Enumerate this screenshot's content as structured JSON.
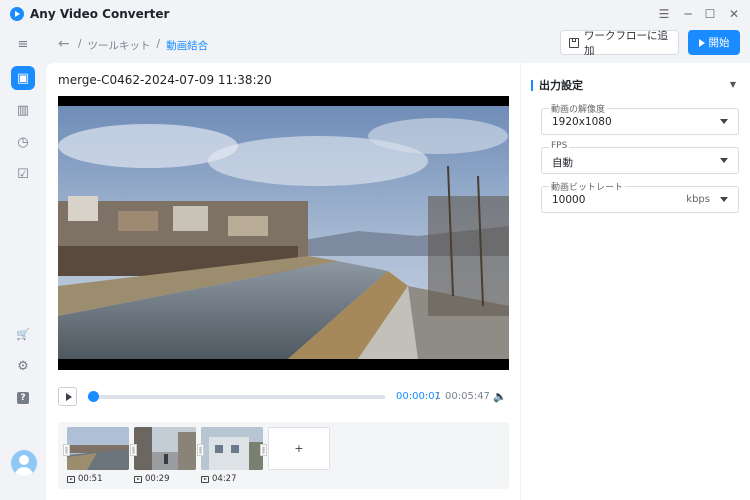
{
  "app": {
    "title": "Any Video Converter"
  },
  "window_controls": {
    "menu": "☰",
    "minimize": "─",
    "maximize": "☐",
    "close": "✕"
  },
  "sidebar": {
    "menu_icon": "≡",
    "items": [
      {
        "name": "toolbox",
        "icon": "toolbox-icon",
        "active": true,
        "glyph": "▣"
      },
      {
        "name": "library",
        "icon": "grid-icon",
        "active": false,
        "glyph": "▥"
      },
      {
        "name": "history",
        "icon": "clock-icon",
        "active": false,
        "glyph": "◷"
      },
      {
        "name": "tasks",
        "icon": "checklist-icon",
        "active": false,
        "glyph": "☑"
      }
    ],
    "bottom": [
      {
        "name": "cart",
        "icon": "cart-icon",
        "glyph": "🛒",
        "color": "#f39c12"
      },
      {
        "name": "settings",
        "icon": "gear-icon",
        "glyph": "⚙"
      },
      {
        "name": "help",
        "icon": "help-icon",
        "glyph": "?"
      }
    ]
  },
  "header": {
    "back_glyph": "←",
    "breadcrumb": [
      "ツールキット",
      "動画結合"
    ],
    "workflow_button": "ワークフローに追加",
    "start_button": "開始"
  },
  "main": {
    "file_title": "merge-C0462-2024-07-09 11:38:20",
    "player": {
      "current_time": "00:00:01",
      "separator": "/",
      "total_time": "00:05:47",
      "progress_fraction": 0.01
    },
    "clips": [
      {
        "duration": "00:51"
      },
      {
        "duration": "00:29"
      },
      {
        "duration": "04:27"
      }
    ],
    "add_clip_label": "+"
  },
  "output": {
    "title": "出力設定",
    "fields": [
      {
        "label": "動画の解像度",
        "value": "1920x1080",
        "unit": ""
      },
      {
        "label": "FPS",
        "value": "自動",
        "unit": ""
      },
      {
        "label": "動画ビットレート",
        "value": "10000",
        "unit": "kbps"
      }
    ]
  },
  "colors": {
    "accent": "#1a8cff",
    "background": "#f1f3f7"
  }
}
